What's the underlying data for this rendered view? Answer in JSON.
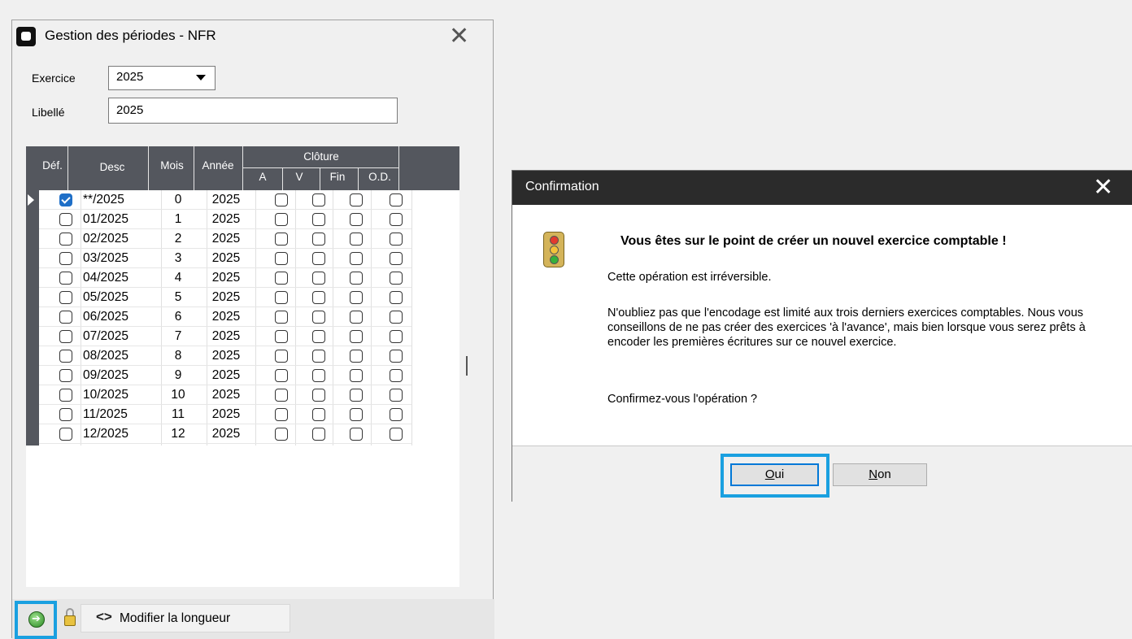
{
  "period_window": {
    "title": "Gestion des périodes - NFR",
    "close_glyph": "✕",
    "exercice_label": "Exercice",
    "exercice_value": "2025",
    "libelle_label": "Libellé",
    "libelle_value": "2025",
    "grid": {
      "headers": {
        "def": "Déf.",
        "desc": "Desc",
        "mois": "Mois",
        "annee": "Année",
        "cloture": "Clôture",
        "a": "A",
        "v": "V",
        "fin": "Fin",
        "od": "O.D."
      },
      "rows": [
        {
          "def": true,
          "desc": "**/2025",
          "mois": "0",
          "annee": "2025"
        },
        {
          "def": false,
          "desc": "01/2025",
          "mois": "1",
          "annee": "2025"
        },
        {
          "def": false,
          "desc": "02/2025",
          "mois": "2",
          "annee": "2025"
        },
        {
          "def": false,
          "desc": "03/2025",
          "mois": "3",
          "annee": "2025"
        },
        {
          "def": false,
          "desc": "04/2025",
          "mois": "4",
          "annee": "2025"
        },
        {
          "def": false,
          "desc": "05/2025",
          "mois": "5",
          "annee": "2025"
        },
        {
          "def": false,
          "desc": "06/2025",
          "mois": "6",
          "annee": "2025"
        },
        {
          "def": false,
          "desc": "07/2025",
          "mois": "7",
          "annee": "2025"
        },
        {
          "def": false,
          "desc": "08/2025",
          "mois": "8",
          "annee": "2025"
        },
        {
          "def": false,
          "desc": "09/2025",
          "mois": "9",
          "annee": "2025"
        },
        {
          "def": false,
          "desc": "10/2025",
          "mois": "10",
          "annee": "2025"
        },
        {
          "def": false,
          "desc": "11/2025",
          "mois": "11",
          "annee": "2025"
        },
        {
          "def": false,
          "desc": "12/2025",
          "mois": "12",
          "annee": "2025"
        }
      ]
    },
    "toolbar": {
      "modify_length_label": "Modifier la longueur",
      "modify_length_glyph": "<>"
    }
  },
  "confirm_dialog": {
    "title": "Confirmation",
    "close_glyph": "✕",
    "heading": "Vous êtes sur le point de créer un  nouvel exercice comptable !",
    "irreversible": "Cette opération est irréversible.",
    "body": "N'oubliez pas que l'encodage est limité aux trois derniers exercices comptables. Nous vous conseillons de ne pas créer des exercices 'à l'avance', mais bien lorsque vous serez prêts à encoder les premières écritures sur ce nouvel exercice.",
    "question": "Confirmez-vous l'opération ?",
    "oui": {
      "mnemonic": "O",
      "rest": "ui"
    },
    "non": {
      "mnemonic": "N",
      "rest": "on"
    }
  },
  "colors": {
    "grid_header": "#54575e",
    "highlight": "#1aa0e0",
    "check_blue": "#1f6fc7",
    "dialog_titlebar": "#2b2b2b"
  }
}
